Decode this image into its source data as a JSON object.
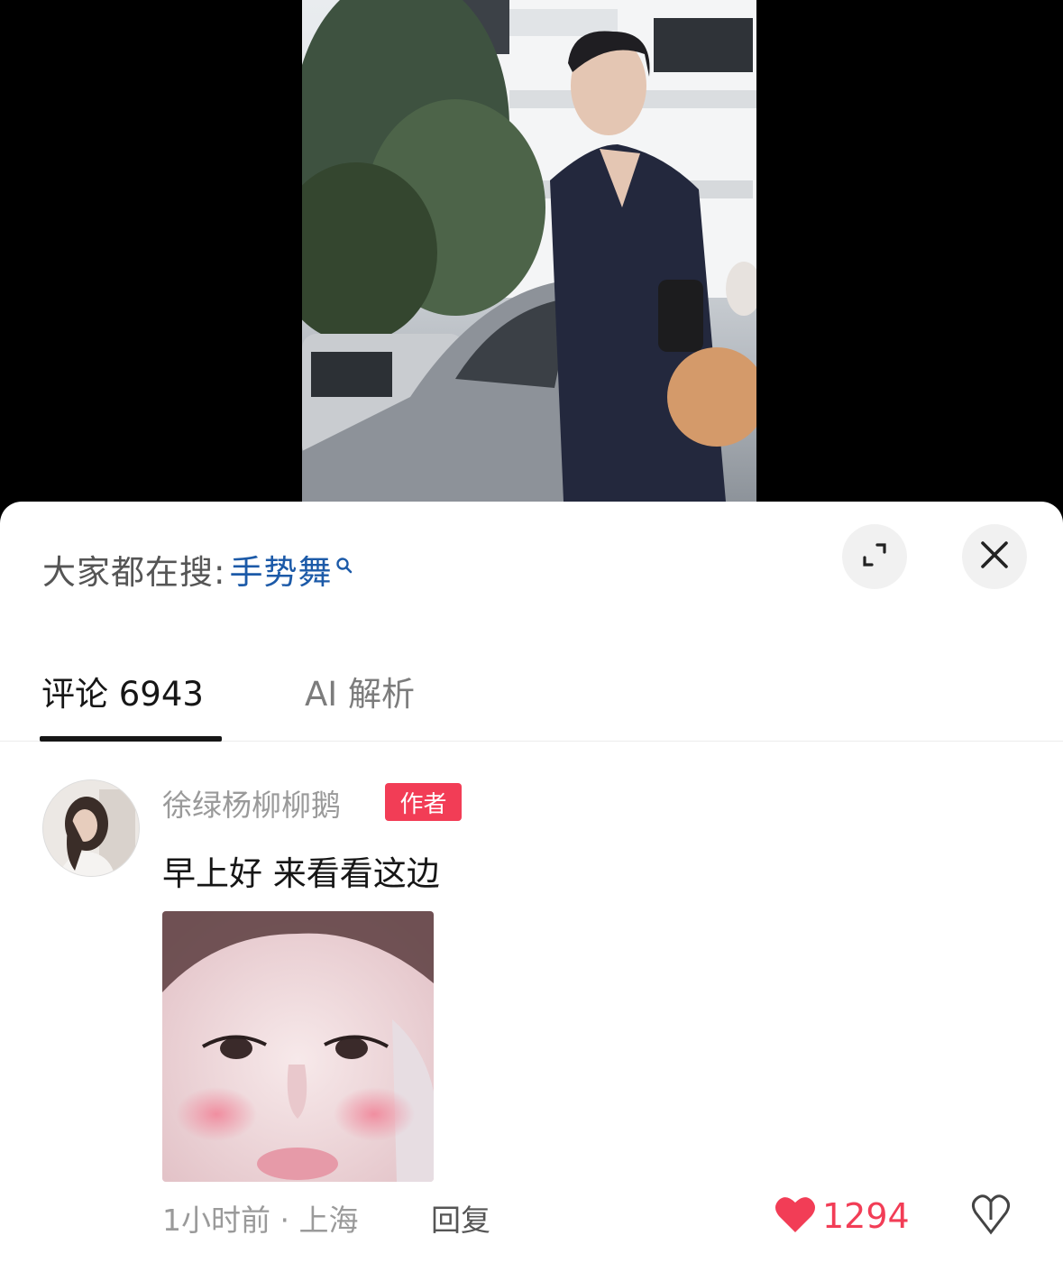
{
  "search_hint": {
    "prefix": "大家都在搜:",
    "term": "手势舞",
    "icon": "search-icon"
  },
  "tabs": [
    {
      "label": "评论 6943",
      "active": true
    },
    {
      "label": "AI 解析",
      "active": false
    }
  ],
  "comment": {
    "username": "徐绿杨柳柳鹅",
    "badge": "作者",
    "text": "早上好 来看看这边",
    "meta": "1小时前 · 上海",
    "reply_label": "回复",
    "like_count": "1294",
    "liked": true
  },
  "colors": {
    "accent": "#f23d56",
    "link": "#1c5aa8",
    "muted": "#9a9a9a"
  }
}
